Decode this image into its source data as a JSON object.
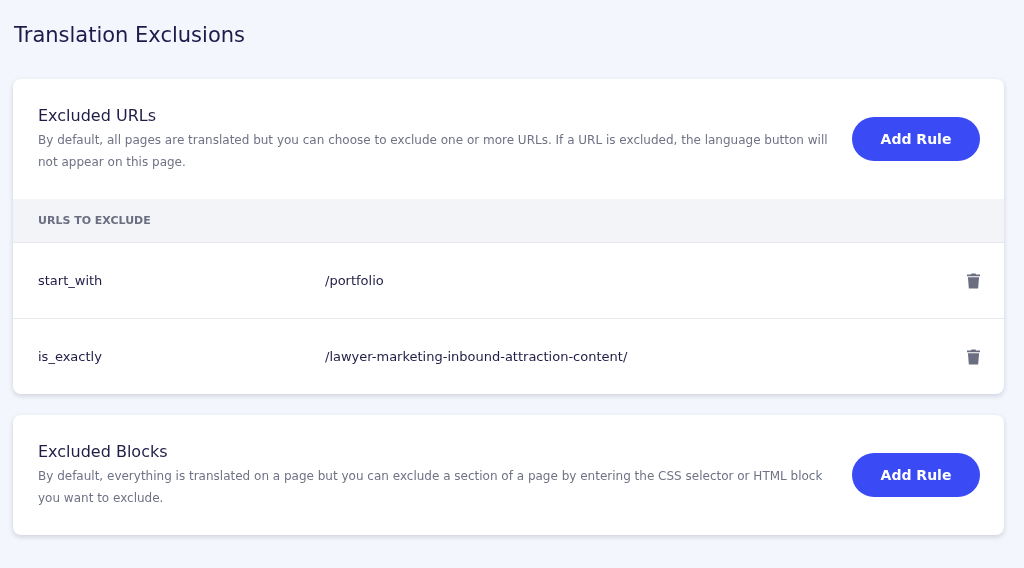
{
  "page_title": "Translation Exclusions",
  "sections": [
    {
      "title": "Excluded URLs",
      "description": "By default, all pages are translated but you can choose to exclude one or more URLs. If a URL is excluded, the language button will not appear on this page.",
      "button": "Add Rule",
      "table": {
        "heading": "URLS TO EXCLUDE",
        "rows": [
          {
            "condition": "start_with",
            "value": "/portfolio"
          },
          {
            "condition": "is_exactly",
            "value": "/lawyer-marketing-inbound-attraction-content/"
          }
        ]
      }
    },
    {
      "title": "Excluded Blocks",
      "description": "By default, everything is translated on a page but you can exclude a section of a page by entering the CSS selector or HTML block you want to exclude.",
      "button": "Add Rule"
    }
  ]
}
